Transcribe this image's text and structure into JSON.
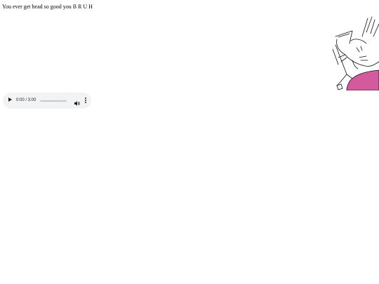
{
  "caption": "You ever get head so good you B R U H",
  "image": {
    "icon": "cat-cartoon-image",
    "accent_color": "#d35a9c",
    "line_color": "#111111"
  },
  "audio_player": {
    "time_display": "0:00 / 3:00",
    "current_time": "0:00",
    "duration": "3:00",
    "progress": 0,
    "icons": {
      "play": "play-icon",
      "volume": "volume-icon",
      "menu": "more-options-icon"
    },
    "background_color": "#f1f3f4"
  }
}
